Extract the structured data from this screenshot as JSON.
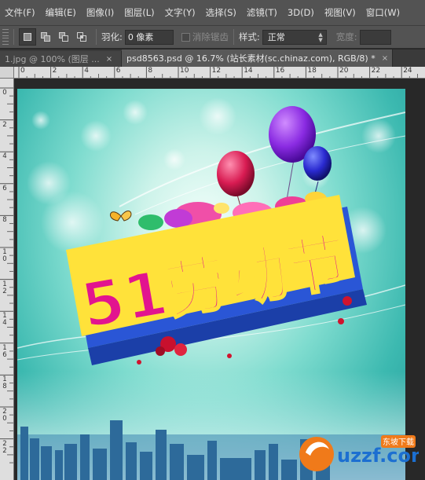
{
  "menu": [
    "文件(F)",
    "编辑(E)",
    "图像(I)",
    "图层(L)",
    "文字(Y)",
    "选择(S)",
    "滤镜(T)",
    "3D(D)",
    "视图(V)",
    "窗口(W)"
  ],
  "options": {
    "feather_label": "羽化:",
    "feather_value": "0 像素",
    "antialias_label": "消除锯齿",
    "style_label": "样式:",
    "style_value": "正常",
    "width_label": "宽度:"
  },
  "tabs": [
    {
      "label": "1.jpg @ 100% (图层 ...",
      "close": "×",
      "active": false
    },
    {
      "label": "psd8563.psd @ 16.7% (站长素材(sc.chinaz.com), RGB/8) *",
      "close": "×",
      "active": true
    }
  ],
  "ruler_top": [
    "0",
    "2",
    "4",
    "6",
    "8",
    "10",
    "12",
    "14",
    "16",
    "18",
    "20",
    "22",
    "24"
  ],
  "ruler_left": [
    "0",
    "2",
    "4",
    "6",
    "8",
    "10",
    "12",
    "14",
    "16",
    "18",
    "20",
    "22"
  ],
  "artwork": {
    "headline": "51劳动节"
  },
  "watermark": {
    "brand": "uzzf.com",
    "badge": "东坡下载"
  },
  "colors": {
    "chrome": "#535353",
    "teal_bg": "#3cb9b0",
    "headline_fill": "#e2148f",
    "headline_side": "#2a56d6",
    "headline_edge": "#ffe23a",
    "balloon_purple": "#8a2be2",
    "balloon_red": "#d81b52",
    "balloon_blue": "#2a2ad0",
    "watermark_orange": "#f07a1a"
  }
}
